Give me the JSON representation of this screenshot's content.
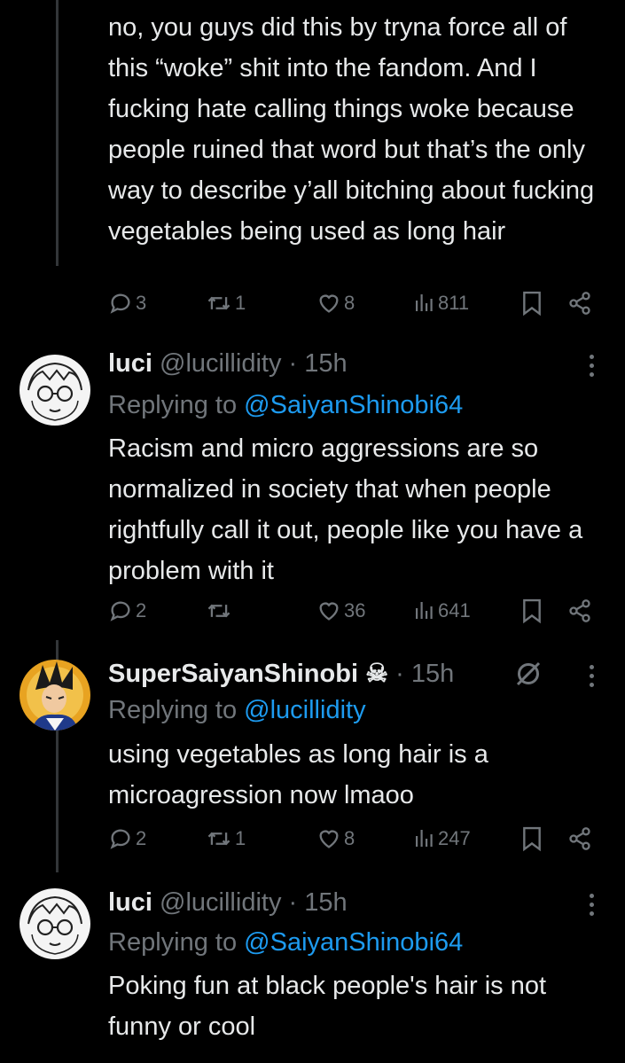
{
  "posts": [
    {
      "text": "no, you guys did this by tryna force all of this “woke” shit into the fandom. And I fucking hate calling things woke because people ruined that word but that’s the only way to describe y’all bitching about fucking vegetables being used as long hair",
      "replies": "3",
      "reposts": "1",
      "likes": "8",
      "views": "811"
    },
    {
      "name": "luci",
      "handle": "@lucillidity",
      "time": "· 15h",
      "replying_label": "Replying to",
      "replying_to": "@SaiyanShinobi64",
      "text": "Racism and micro aggressions are so normalized in society that when people rightfully call it out, people like you have a problem with it",
      "replies": "2",
      "reposts": "",
      "likes": "36",
      "views": "641"
    },
    {
      "name": "SuperSaiyanShinobi",
      "badge": "☠",
      "time": "· 15h",
      "replying_label": "Replying to",
      "replying_to": "@lucillidity",
      "text": "using vegetables as long hair is a microagression now lmaoo",
      "replies": "2",
      "reposts": "1",
      "likes": "8",
      "views": "247"
    },
    {
      "name": "luci",
      "handle": "@lucillidity",
      "time": "· 15h",
      "replying_label": "Replying to",
      "replying_to": "@SaiyanShinobi64",
      "text": "Poking fun at black people's hair is not funny or cool"
    }
  ],
  "icons": {
    "reply": "reply-icon",
    "repost": "repost-icon",
    "like": "heart-icon",
    "views": "views-icon",
    "bookmark": "bookmark-icon",
    "share": "share-icon",
    "more": "more-icon",
    "mute": "mute-icon"
  },
  "colors": {
    "background": "#000000",
    "text": "#e7e9ea",
    "muted": "#71767b",
    "link": "#1d9bf0"
  }
}
